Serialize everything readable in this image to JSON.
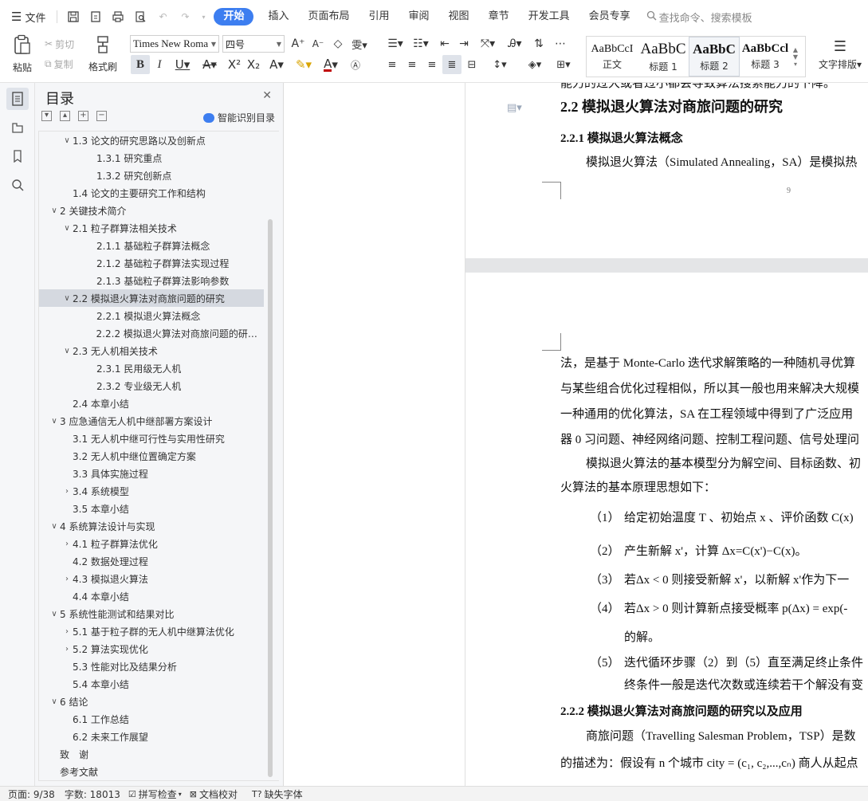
{
  "menubar": {
    "file_label": "文件",
    "tabs": [
      {
        "label": "开始",
        "active": true
      },
      {
        "label": "插入"
      },
      {
        "label": "页面布局"
      },
      {
        "label": "引用"
      },
      {
        "label": "审阅"
      },
      {
        "label": "视图"
      },
      {
        "label": "章节"
      },
      {
        "label": "开发工具"
      },
      {
        "label": "会员专享"
      }
    ],
    "search_placeholder": "查找命令、搜索模板"
  },
  "ribbon": {
    "paste_label": "粘贴",
    "cut_label": "剪切",
    "copy_label": "复制",
    "format_painter_label": "格式刷",
    "font_name": "Times New Roma",
    "font_size": "四号",
    "styles": [
      {
        "sample": "AaBbCcI",
        "name": "正文"
      },
      {
        "sample": "AaBbC",
        "name": "标题 1"
      },
      {
        "sample": "AaBbC",
        "name": "标题 2"
      },
      {
        "sample": "AaBbCcl",
        "name": "标题 3"
      }
    ],
    "text_layout_label": "文字排版"
  },
  "toc": {
    "title": "目录",
    "smart_label": "智能识别目录",
    "items": [
      {
        "text": "1.3 论文的研究思路以及创新点",
        "level": 2,
        "arrow": "down"
      },
      {
        "text": "1.3.1 研究重点",
        "level": 3,
        "arrow": ""
      },
      {
        "text": "1.3.2 研究创新点",
        "level": 3,
        "arrow": ""
      },
      {
        "text": "1.4 论文的主要研究工作和结构",
        "level": 2,
        "arrow": ""
      },
      {
        "text": "2 关键技术简介",
        "level": 1,
        "arrow": "down"
      },
      {
        "text": "2.1 粒子群算法相关技术",
        "level": 2,
        "arrow": "down"
      },
      {
        "text": "2.1.1 基础粒子群算法概念",
        "level": 3,
        "arrow": ""
      },
      {
        "text": "2.1.2 基础粒子群算法实现过程",
        "level": 3,
        "arrow": ""
      },
      {
        "text": "2.1.3 基础粒子群算法影响参数",
        "level": 3,
        "arrow": ""
      },
      {
        "text": "2.2 模拟退火算法对商旅问题的研究",
        "level": 2,
        "arrow": "down",
        "selected": true
      },
      {
        "text": "2.2.1 模拟退火算法概念",
        "level": 3,
        "arrow": ""
      },
      {
        "text": "2.2.2 模拟退火算法对商旅问题的研究 ...",
        "level": 3,
        "arrow": ""
      },
      {
        "text": "2.3 无人机相关技术",
        "level": 2,
        "arrow": "down"
      },
      {
        "text": "2.3.1 民用级无人机",
        "level": 3,
        "arrow": ""
      },
      {
        "text": "2.3.2 专业级无人机",
        "level": 3,
        "arrow": ""
      },
      {
        "text": "2.4 本章小结",
        "level": 2,
        "arrow": ""
      },
      {
        "text": "3 应急通信无人机中继部署方案设计",
        "level": 1,
        "arrow": "down"
      },
      {
        "text": "3.1 无人机中继可行性与实用性研究",
        "level": 2,
        "arrow": ""
      },
      {
        "text": "3.2 无人机中继位置确定方案",
        "level": 2,
        "arrow": ""
      },
      {
        "text": "3.3 具体实施过程",
        "level": 2,
        "arrow": ""
      },
      {
        "text": "3.4 系统模型",
        "level": 2,
        "arrow": "right"
      },
      {
        "text": "3.5 本章小结",
        "level": 2,
        "arrow": ""
      },
      {
        "text": "4 系统算法设计与实现",
        "level": 1,
        "arrow": "down"
      },
      {
        "text": "4.1 粒子群算法优化",
        "level": 2,
        "arrow": "right"
      },
      {
        "text": "4.2 数据处理过程",
        "level": 2,
        "arrow": ""
      },
      {
        "text": "4.3 模拟退火算法",
        "level": 2,
        "arrow": "right"
      },
      {
        "text": "4.4 本章小结",
        "level": 2,
        "arrow": ""
      },
      {
        "text": "5 系统性能测试和结果对比",
        "level": 1,
        "arrow": "down"
      },
      {
        "text": "5.1 基于粒子群的无人机中继算法优化",
        "level": 2,
        "arrow": "right"
      },
      {
        "text": "5.2 算法实现优化",
        "level": 2,
        "arrow": "right"
      },
      {
        "text": "5.3 性能对比及结果分析",
        "level": 2,
        "arrow": ""
      },
      {
        "text": "5.4 本章小结",
        "level": 2,
        "arrow": ""
      },
      {
        "text": "6 结论",
        "level": 1,
        "arrow": "down"
      },
      {
        "text": "6.1 工作总结",
        "level": 2,
        "arrow": ""
      },
      {
        "text": "6.2 未来工作展望",
        "level": 2,
        "arrow": ""
      },
      {
        "text": "致　谢",
        "level": 0,
        "arrow": ""
      },
      {
        "text": "参考文献",
        "level": 0,
        "arrow": ""
      }
    ]
  },
  "document": {
    "cut_top_line": "能力的过大或者过小都会导致算法搜索能力的下降。",
    "heading_22": "2.2 模拟退火算法对商旅问题的研究",
    "heading_221": "2.2.1 模拟退火算法概念",
    "para_221": "模拟退火算法（Simulated Annealing，SA）是模拟热",
    "page_number": "9",
    "lines": [
      "法，是基于 Monte-Carlo 迭代求解策略的一种随机寻优算",
      "与某些组合优化过程相似，所以其一般也用来解决大规模",
      "一种通用的优化算法，SA 在工程领域中得到了广泛应用",
      "器 0 习问题、神经网络问题、控制工程问题、信号处理问",
      "模拟退火算法的基本模型分为解空间、目标函数、初",
      "火算法的基本原理思想如下："
    ],
    "steps": [
      {
        "num": "（1）",
        "text": "给定初始温度 T 、初始点 x 、评价函数 C(x)"
      },
      {
        "num": "（2）",
        "text": "产生新解 x'，计算 Δx=C(x')−C(x)。"
      },
      {
        "num": "（3）",
        "text": "若Δx < 0 则接受新解 x'，以新解 x'作为下一"
      },
      {
        "num": "（4）",
        "text": "若Δx > 0 则计算新点接受概率 p(Δx) = exp(-"
      },
      {
        "num": "",
        "text": "的解。"
      },
      {
        "num": "（5）",
        "text": "迭代循环步骤（2）到（5）直至满足终止条件"
      },
      {
        "num": "",
        "text": "终条件一般是迭代次数或连续若干个解没有变"
      }
    ],
    "heading_222": "2.2.2 模拟退火算法对商旅问题的研究以及应用",
    "para_222_a": "商旅问题（Travelling Salesman Problem，TSP）是数",
    "para_222_b": "的描述为：假设有 n 个城市 city = (c₁, c₂,...,cₙ) 商人从起点"
  },
  "status": {
    "page": "页面: 9/38",
    "words": "字数: 18013",
    "spell": "拼写检查",
    "proof": "文档校对",
    "missing_font": "缺失字体"
  }
}
